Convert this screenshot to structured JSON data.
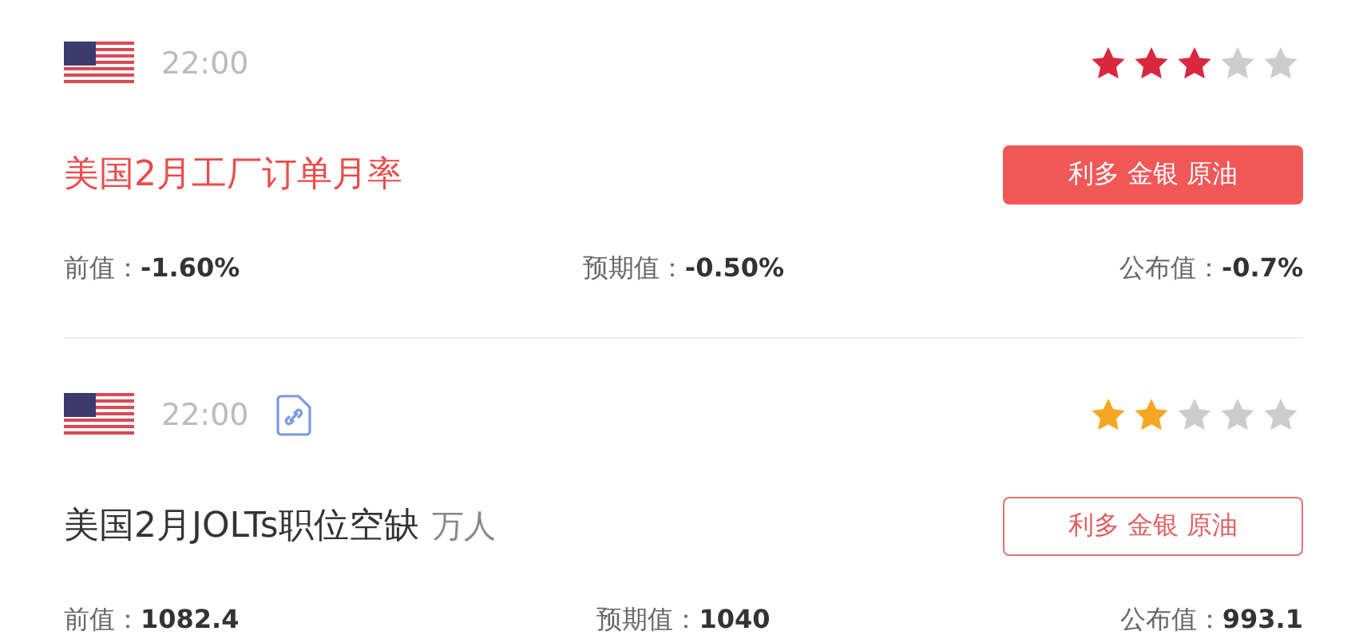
{
  "items": [
    {
      "time": "22:00",
      "attachment": false,
      "stars": 3,
      "color": "#d9283e",
      "title": "美国2月工厂订单月率",
      "important": true,
      "tag": {
        "text": "利多 金银 原油",
        "kind": "solid"
      },
      "values": [
        {
          "label": "前值：",
          "value": "-1.60%"
        },
        {
          "label": "预期值：",
          "value": "-0.50%"
        },
        {
          "label": "公布值：",
          "value": "-0.7%"
        }
      ]
    },
    {
      "time": "22:00",
      "attachment": true,
      "stars": 2,
      "color": "#f5a623",
      "title": "美国2月JOLTs职位空缺",
      "unit": "万人",
      "important": false,
      "tag": {
        "text": "利多 金银 原油",
        "kind": "outline"
      },
      "values": [
        {
          "label": "前值：",
          "value": "1082.4"
        },
        {
          "label": "预期值：",
          "value": "1040"
        },
        {
          "label": "公布值：",
          "value": "993.1"
        }
      ]
    }
  ]
}
